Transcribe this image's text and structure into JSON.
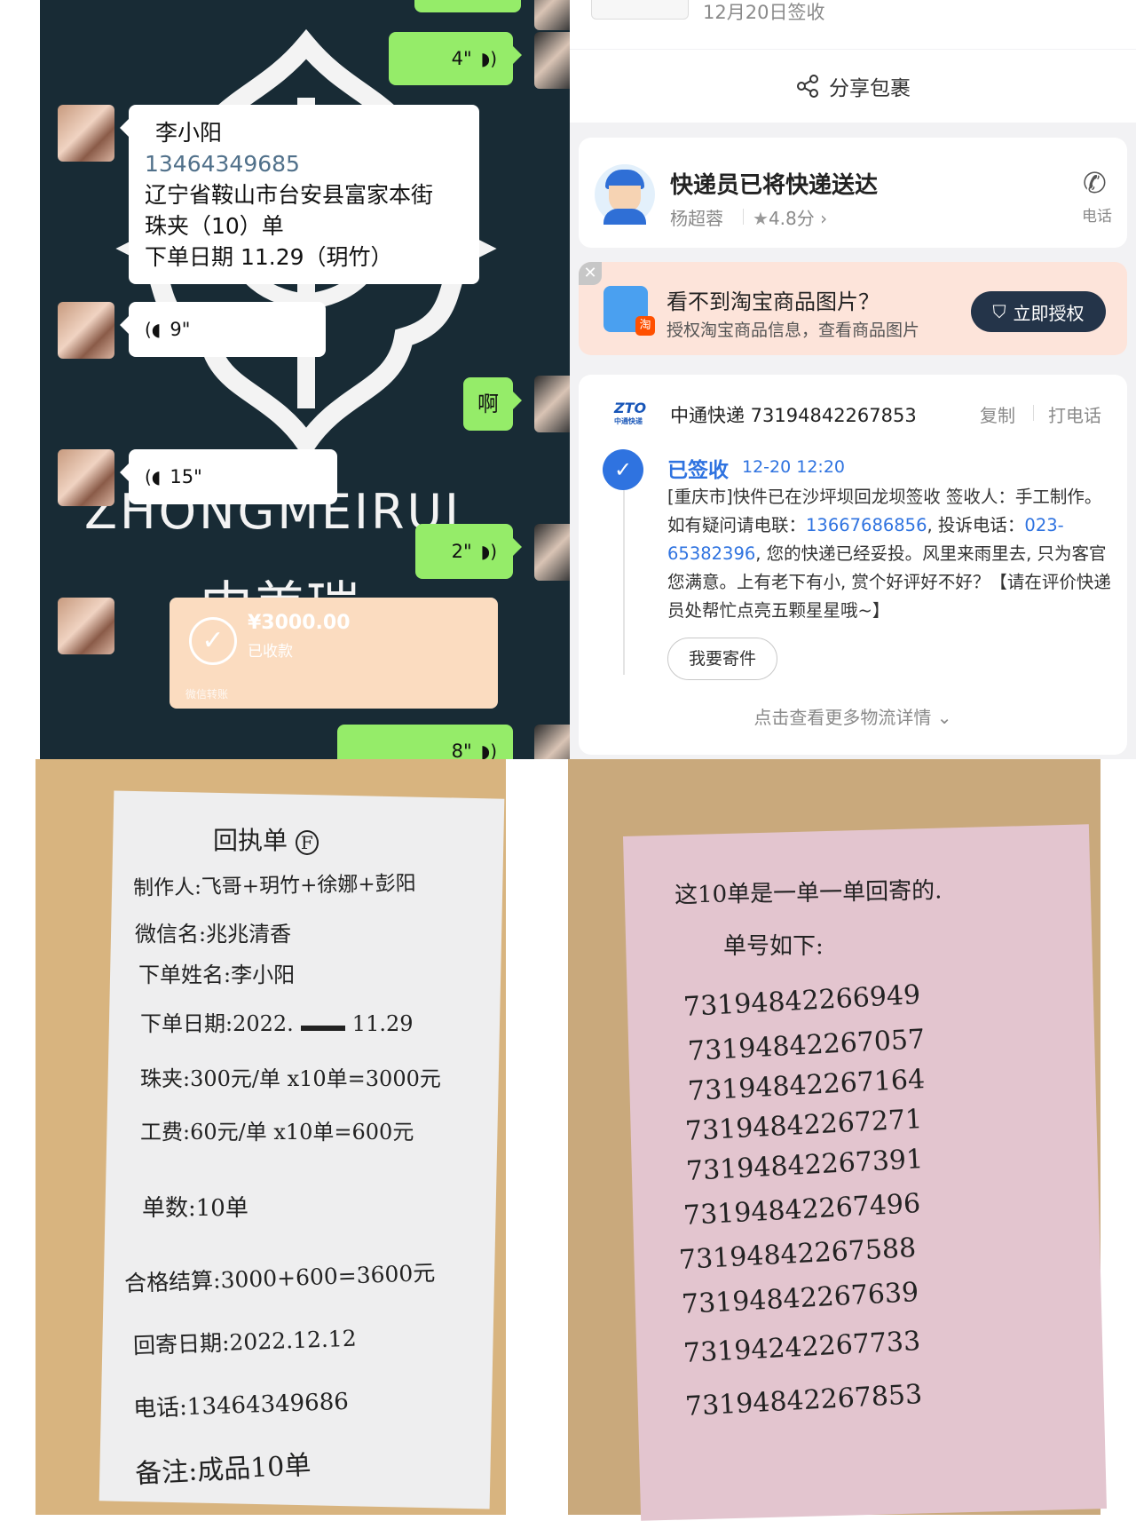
{
  "chat": {
    "voice_top_right": "4\"",
    "order_card": {
      "name": "李小阳",
      "phone": "13464349685",
      "address": "辽宁省鞍山市台安县富家本街",
      "item": "珠夹（10）单",
      "order_date": "下单日期 11.29（玥竹）"
    },
    "voice_1": "9\"",
    "reply_text": "啊",
    "voice_2": "15\"",
    "voice_3": "2\"",
    "watermark_latin": "ZHONGMEIRUI",
    "watermark_cn": "中美瑞",
    "payment": {
      "amount": "¥3000.00",
      "status": "已收款",
      "footer": "微信转账"
    },
    "voice_4": "8\"",
    "voice_icon": "voice-wave-icon"
  },
  "logistics": {
    "signed_date": "12月20日签收",
    "share_label": "分享包裹",
    "courier": {
      "title": "快递员已将快递送达",
      "name": "杨超蓉",
      "rating": "4.8分",
      "phone_label": "电话"
    },
    "auth_banner": {
      "title": "看不到淘宝商品图片？",
      "subtitle": "授权淘宝商品信息，查看商品图片",
      "button": "立即授权",
      "badge": "淘"
    },
    "tracking": {
      "logo": "ZTO",
      "logo_sub": "中通快递",
      "carrier_number": "中通快递 73194842267853",
      "copy": "复制",
      "call": "打电话",
      "status": "已签收",
      "time": "12-20 12:20",
      "detail_1": "[重庆市]快件已在沙坪坝回龙坝签收 签收人：手工制作。如有疑问请电联：",
      "contact_phone": "13667686856",
      "detail_2": ", 投诉电话：",
      "complaint_phone": "023-65382396",
      "detail_3": ", 您的快递已经妥投。风里来雨里去, 只为客官您满意。上有老下有小, 赏个好评好不好？【请在评价快递员处帮忙点亮五颗星星哦~】",
      "send_button": "我要寄件",
      "more_link": "点击查看更多物流详情"
    }
  },
  "receipt": {
    "title": "回执单",
    "title_mark": "F",
    "line_makers": "制作人:飞哥+玥竹+徐娜+彭阳",
    "line_wechat": "微信名:兆兆清香",
    "line_name": "下单姓名:李小阳",
    "line_date_a": "下单日期:2022.",
    "line_date_b": "11.29",
    "line_price": "珠夹:300元/单 x10单=3000元",
    "line_wage": "工费:60元/单 x10单=600元",
    "line_count": "单数:10单",
    "line_total": "合格结算:3000+600=3600元",
    "line_return": "回寄日期:2022.12.12",
    "line_phone": "电话:13464349686",
    "line_note": "备注:成品10单"
  },
  "numbers_note": {
    "line1": "这10单是一单一单回寄的.",
    "line2": "单号如下:",
    "tracking_numbers": [
      "73194842266949",
      "73194842267057",
      "73194842267164",
      "73194842267271",
      "73194842267391",
      "73194842267496",
      "73194842267588",
      "73194842267639",
      "73194242267733",
      "73194842267853"
    ]
  }
}
